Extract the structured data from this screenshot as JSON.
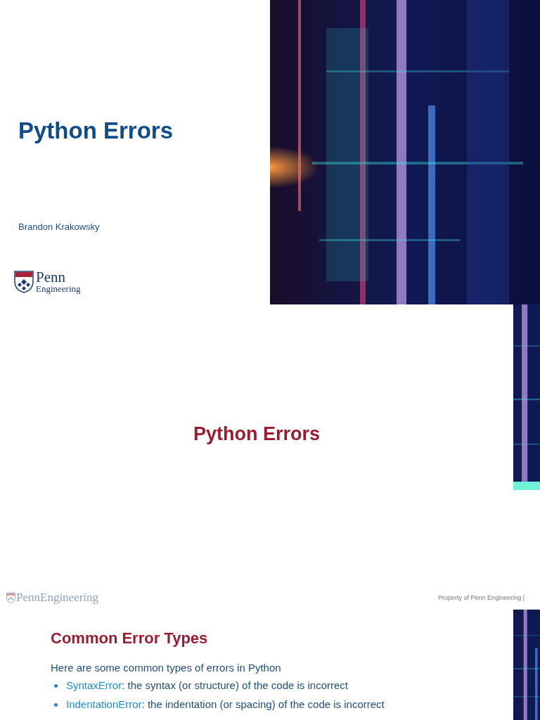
{
  "slides": [
    {
      "kind": "title",
      "title": "Python Errors",
      "author": "Brandon Krakowsky",
      "logo": {
        "line_1": "Penn",
        "line_2": "Engineering"
      }
    },
    {
      "kind": "section",
      "title": "Python Errors"
    },
    {
      "kind": "content",
      "header_logo": "PennEngineering",
      "footer": "Property of Penn Engineering |",
      "title": "Common Error Types",
      "intro": "Here are some common types of errors in Python",
      "bullets": [
        {
          "term": "SyntaxError",
          "text": ": the syntax (or structure) of the code is incorrect"
        },
        {
          "term": "IndentationError",
          "text": ": the indentation (or spacing) of the code is incorrect"
        }
      ]
    }
  ]
}
